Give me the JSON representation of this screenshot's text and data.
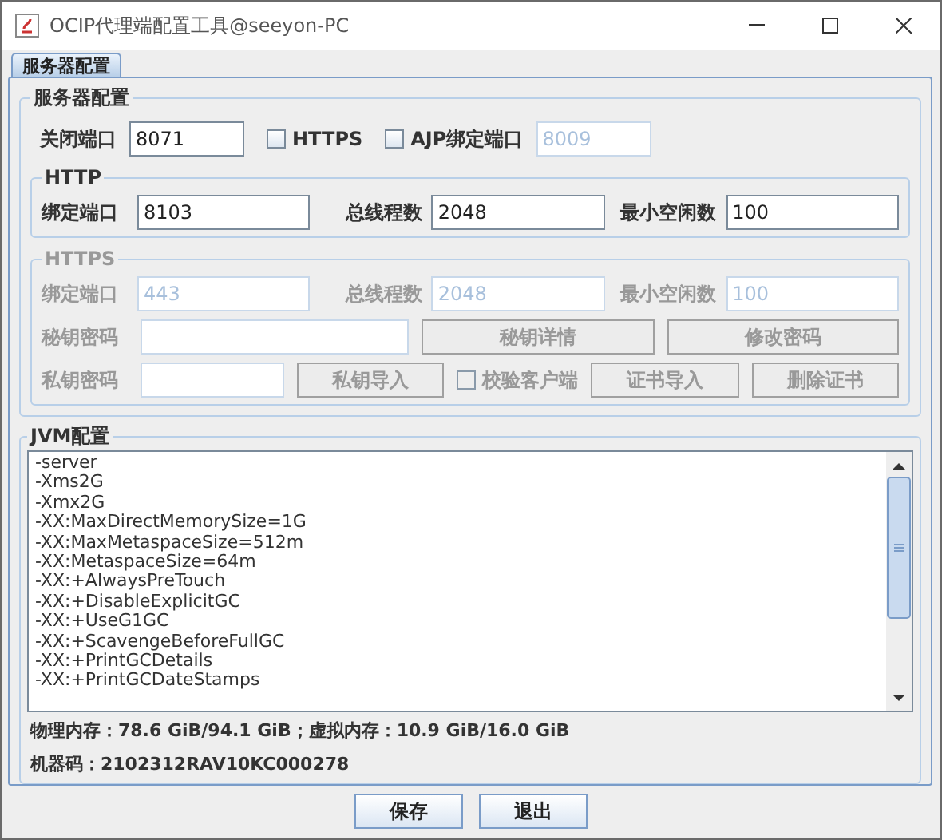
{
  "window": {
    "title": "OCIP代理端配置工具@seeyon-PC"
  },
  "tabs": [
    {
      "label": "服务器配置",
      "selected": true
    }
  ],
  "server": {
    "title": "服务器配置",
    "shutdown": {
      "label": "关闭端口",
      "value": "8071"
    },
    "https_option": {
      "label": "HTTPS",
      "checked": false
    },
    "ajp_option": {
      "label": "AJP绑定端口",
      "checked": false,
      "value": "8009"
    }
  },
  "http": {
    "title": "HTTP",
    "disabled": false,
    "fields": [
      {
        "label": "绑定端口",
        "value": "8103"
      },
      {
        "label": "总线程数",
        "value": "2048"
      },
      {
        "label": "最小空闲数",
        "value": "100"
      }
    ]
  },
  "https": {
    "title": "HTTPS",
    "disabled": true,
    "fields": [
      {
        "label": "绑定端口",
        "value": "443"
      },
      {
        "label": "总线程数",
        "value": "2048"
      },
      {
        "label": "最小空闲数",
        "value": "100"
      }
    ],
    "key_password": {
      "label": "秘钥密码",
      "buttons": [
        "秘钥详情",
        "修改密码"
      ]
    },
    "private_key": {
      "label": "私钥密码",
      "import_button": "私钥导入",
      "verify_option": {
        "label": "校验客户端",
        "checked": false
      },
      "buttons": [
        "证书导入",
        "删除证书"
      ]
    }
  },
  "jvm": {
    "title": "JVM配置",
    "lines": [
      "-server",
      "-Xms2G",
      "-Xmx2G",
      "-XX:MaxDirectMemorySize=1G",
      "-XX:MaxMetaspaceSize=512m",
      "-XX:MetaspaceSize=64m",
      "-XX:+AlwaysPreTouch",
      "-XX:+DisableExplicitGC",
      "-XX:+UseG1GC",
      "-XX:+ScavengeBeforeFullGC",
      "-XX:+PrintGCDetails",
      "-XX:+PrintGCDateStamps"
    ],
    "memory": "物理内存：78.6 GiB/94.1 GiB；虚拟内存：10.9 GiB/16.0 GiB",
    "machine": "机器码：2102312RAV10KC000278"
  },
  "buttons": [
    "保存",
    "退出"
  ]
}
